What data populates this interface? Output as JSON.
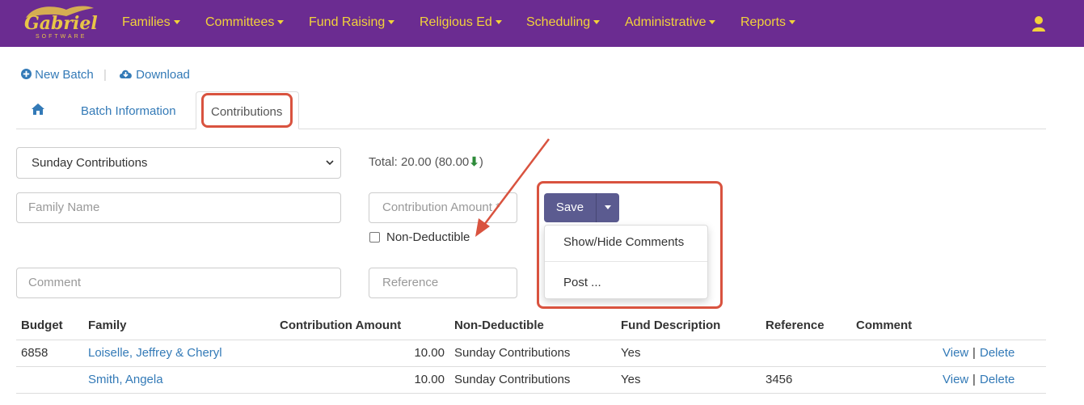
{
  "app": {
    "logo_text": "Gabriel",
    "logo_sub": "SOFTWARE",
    "brand_color": "#6b2c91",
    "accent_color": "#f2d23a"
  },
  "nav": {
    "items": [
      "Families",
      "Committees",
      "Fund Raising",
      "Religious Ed",
      "Scheduling",
      "Administrative",
      "Reports"
    ],
    "user_icon": "user-icon"
  },
  "actions": {
    "new_batch": "New Batch",
    "separator": "|",
    "download": "Download"
  },
  "tabs": {
    "home_icon": "home-icon",
    "batch_info": "Batch Information",
    "contributions": "Contributions"
  },
  "form": {
    "fund_select": "Sunday Contributions",
    "total": "Total: 20.00 (80.00",
    "total_arrow": "⬇",
    "total_close": ")",
    "family_name_placeholder": "Family Name",
    "contribution_amount_placeholder": "Contribution Amount *",
    "non_deductible_label": "Non-Deductible",
    "comment_placeholder": "Comment",
    "reference_placeholder": "Reference",
    "save_label": "Save",
    "dropdown_items": [
      "Show/Hide Comments",
      "Post ..."
    ]
  },
  "table": {
    "headers": [
      "Budget",
      "Family",
      "Contribution Amount",
      "Non-Deductible",
      "Fund Description",
      "Reference",
      "Comment"
    ],
    "rows": [
      {
        "budget": "6858",
        "family": "Loiselle, Jeffrey & Cheryl",
        "amount": "10.00",
        "fund": "Sunday Contributions",
        "nondeductible": "Yes",
        "reference": "",
        "comment": "",
        "view": "View",
        "pipe": "|",
        "delete": "Delete"
      },
      {
        "budget": "",
        "family": "Smith, Angela",
        "amount": "10.00",
        "fund": "Sunday Contributions",
        "nondeductible": "Yes",
        "reference": "3456",
        "comment": "",
        "view": "View",
        "pipe": "|",
        "delete": "Delete"
      }
    ]
  },
  "annotation_color": "#d9533f"
}
